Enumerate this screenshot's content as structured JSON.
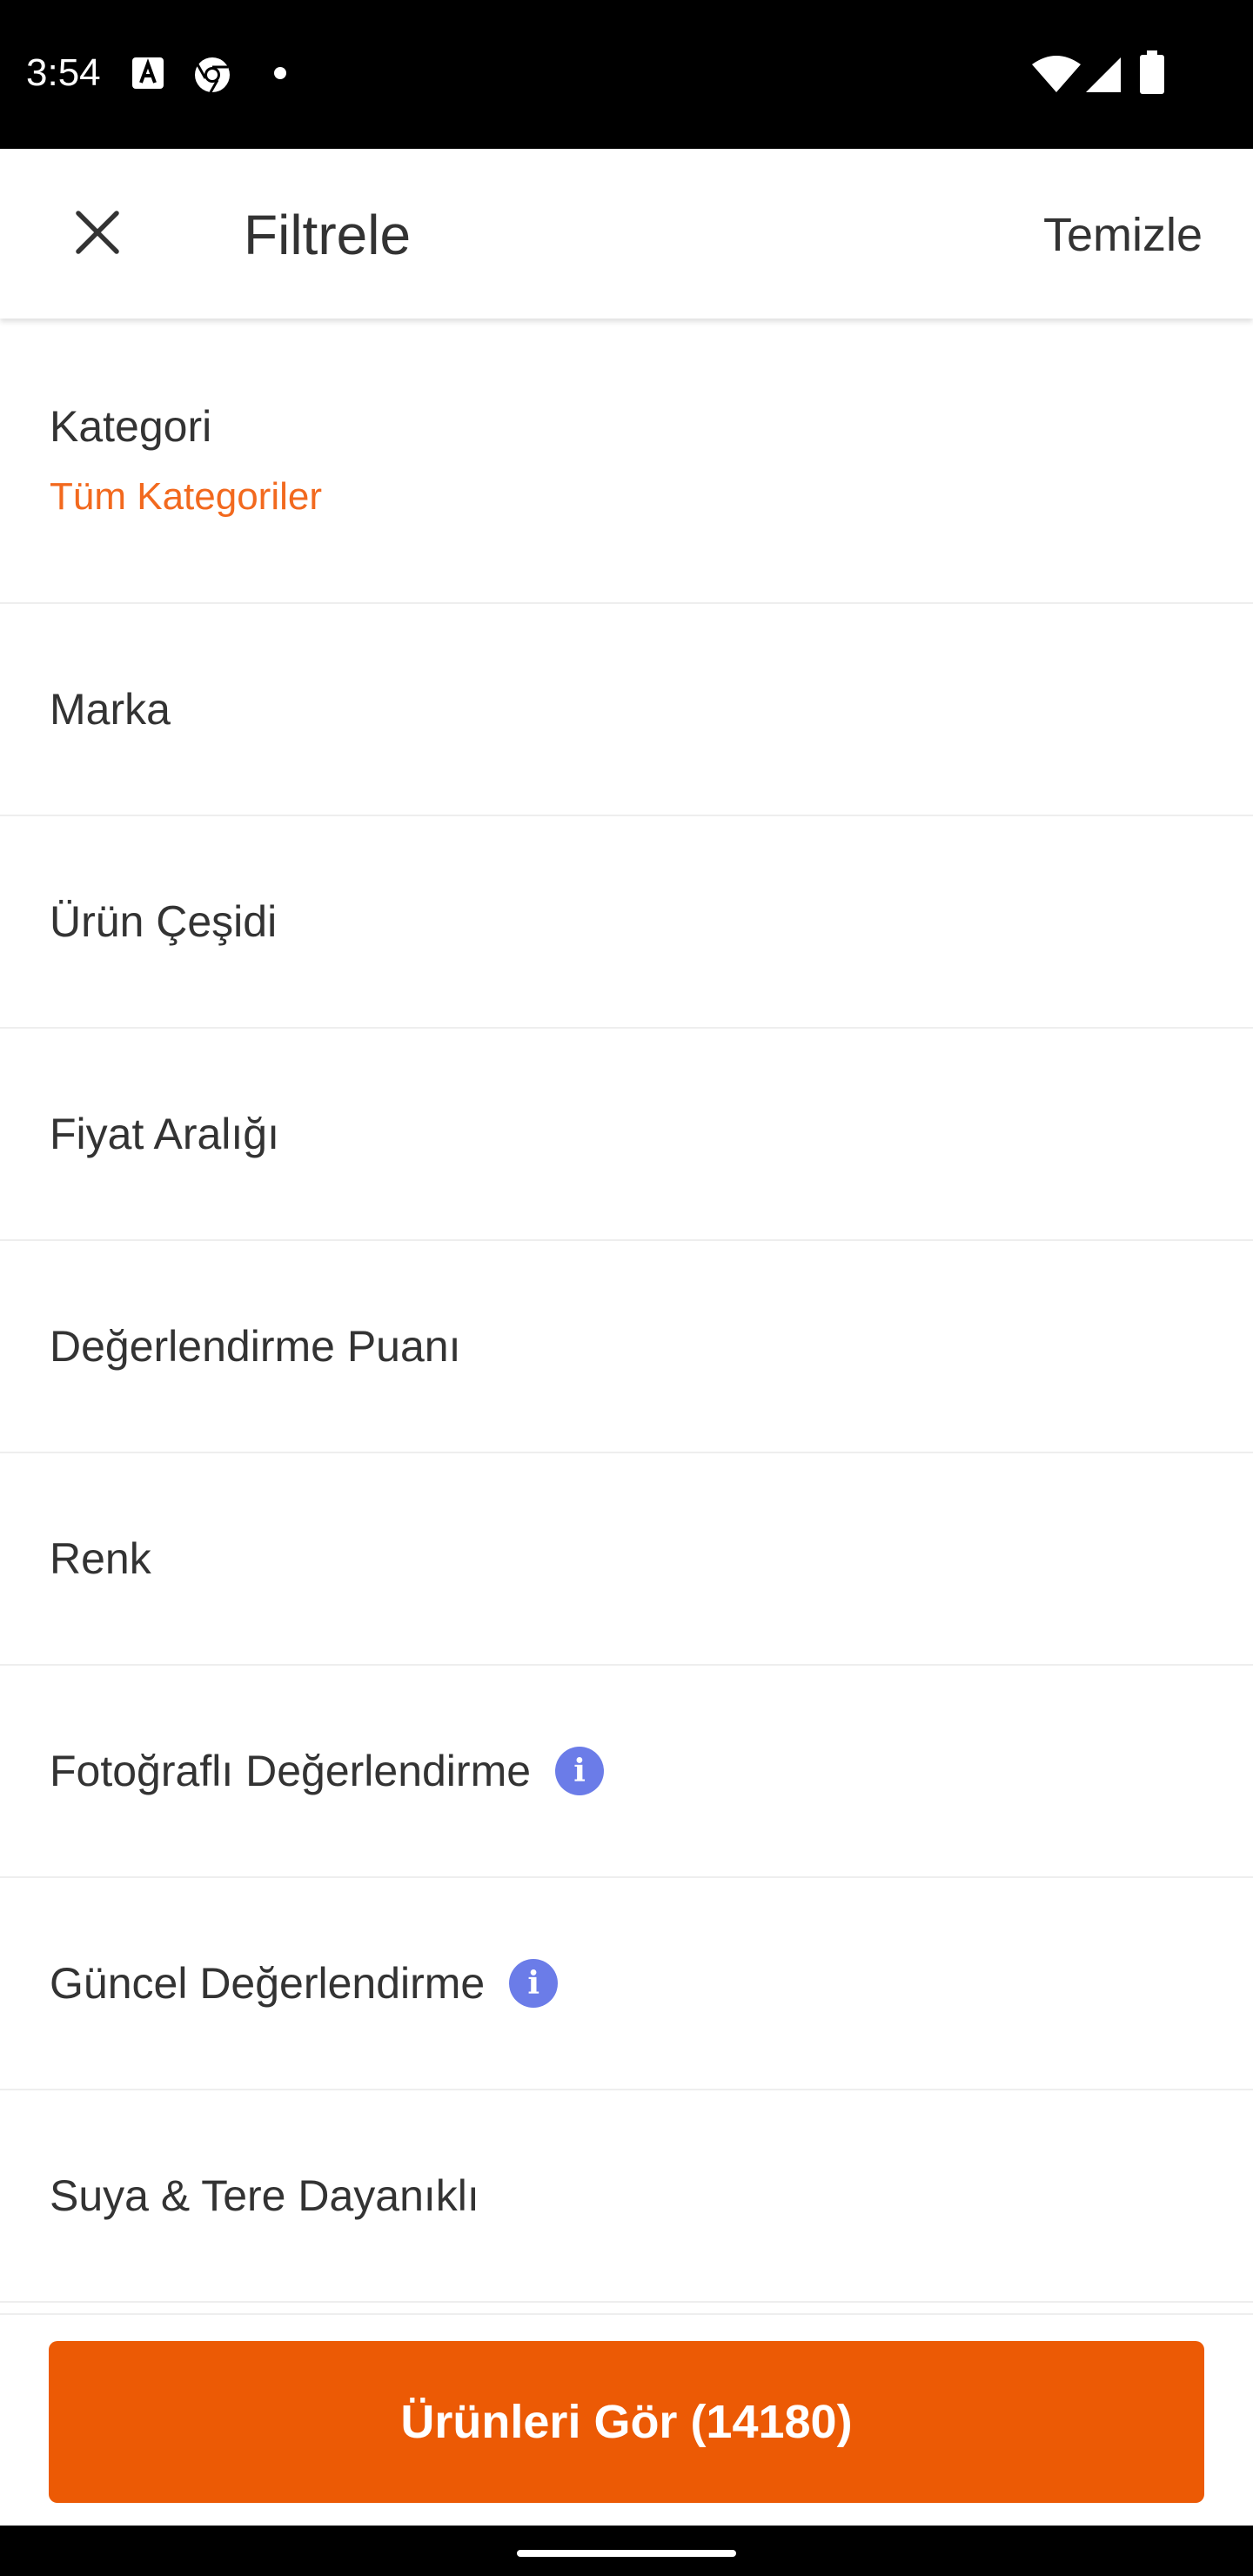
{
  "status_bar": {
    "time": "3:54",
    "icons": [
      "a-notification-icon",
      "chrome-icon",
      "dot-icon",
      "wifi-icon",
      "signal-icon",
      "battery-icon"
    ]
  },
  "header": {
    "title": "Filtrele",
    "clear_label": "Temizle",
    "close_icon": "close-icon"
  },
  "filters": [
    {
      "label": "Kategori",
      "value": "Tüm Kategoriler"
    },
    {
      "label": "Marka"
    },
    {
      "label": "Ürün Çeşidi"
    },
    {
      "label": "Fiyat Aralığı"
    },
    {
      "label": "Değerlendirme Puanı"
    },
    {
      "label": "Renk"
    },
    {
      "label": "Fotoğraflı Değerlendirme",
      "info_icon": "info-icon"
    },
    {
      "label": "Güncel Değerlendirme",
      "info_icon": "info-icon"
    },
    {
      "label": "Suya & Tere Dayanıklı"
    }
  ],
  "bottom": {
    "button_label": "Ürünleri Gör (14180)"
  },
  "colors": {
    "accent": "#ec5a05",
    "selected_text": "#f2691e",
    "info": "#6b7ce8",
    "text": "#333333"
  }
}
